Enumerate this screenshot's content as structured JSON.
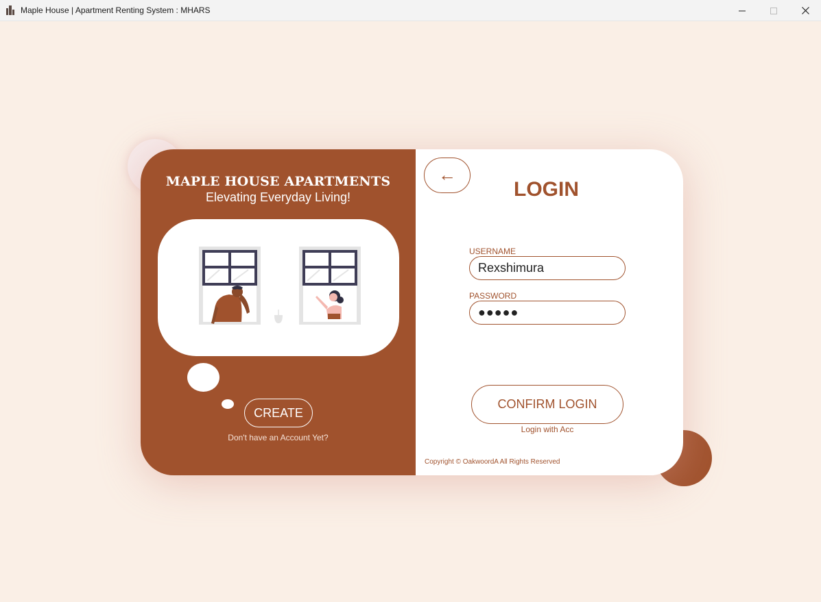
{
  "window": {
    "title": "Maple House | Apartment Renting System : MHARS",
    "controls": [
      "minimize-icon",
      "maximize-icon",
      "close-icon"
    ]
  },
  "brand": {
    "title": "MAPLE HOUSE APARTMENTS",
    "subtitle": "Elevating Everyday Living!"
  },
  "left": {
    "create_label": "CREATE",
    "no_account_text": "Don't have an Account Yet?"
  },
  "login": {
    "back_label": "←",
    "title": "LOGIN",
    "username_label": "USERNAME",
    "username_value": "Rexshimura",
    "password_label": "PASSWORD",
    "password_value": "●●●●●",
    "confirm_label": "CONFIRM LOGIN",
    "login_with_acc": "Login with Acc",
    "copyright": "Copyright © OakwoordA All Rights Reserved"
  },
  "colors": {
    "accent": "#a0522d",
    "background": "#faefe6",
    "panel": "#ffffff"
  }
}
